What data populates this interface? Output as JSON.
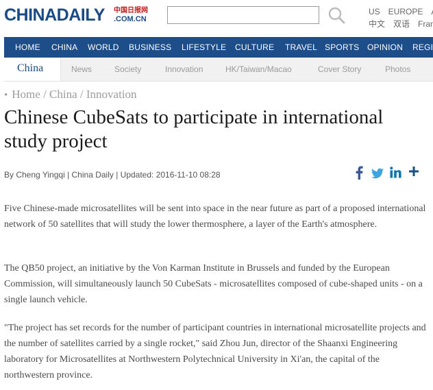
{
  "header": {
    "logo_text": "CHINADAILY",
    "logo_cn": "中国日报网",
    "logo_domain": ".COM.CN",
    "search": {
      "placeholder": ""
    },
    "lang_top": [
      "US",
      "EUROPE",
      "A"
    ],
    "lang_bottom": [
      "中文",
      "双语",
      "Fran"
    ]
  },
  "nav": {
    "items": [
      "HOME",
      "CHINA",
      "WORLD",
      "BUSINESS",
      "LIFESTYLE",
      "CULTURE",
      "TRAVEL",
      "SPORTS",
      "OPINION",
      "REGI"
    ]
  },
  "subnav": {
    "active": "China",
    "items": [
      "News",
      "Society",
      "Innovation",
      "HK/Taiwan/Macao",
      "Cover Story",
      "Photos"
    ]
  },
  "breadcrumb": {
    "items": [
      "Home",
      "China",
      "Innovation"
    ]
  },
  "article": {
    "title": "Chinese CubeSats to participate in international study project",
    "byline": "By Cheng Yingqi | China Daily | Updated: 2016-11-10 08:28",
    "paragraphs": [
      "Five Chinese-made microsatellites will be sent into space in the near future as part of a proposed international network of 50 satellites that will study the lower thermosphere, a layer of the Earth's atmosphere.",
      "The QB50 project, an initiative by the Von Karman Institute in Brussels and funded by the European Commission, will simultaneously launch 50 CubeSats - microsatellites composed of cube-shaped units - on a single launch vehicle.",
      "\"The project has set records for the number of participant countries in international microsatellite projects and the number of satellites carried by a single rocket,\" said Zhou Jun, director of the Shaanxi Engineering laboratory for Microsatellites at Northwestern Polytechnical University in Xi'an, the capital of the northwestern province."
    ]
  },
  "share": {
    "icons": [
      "facebook-icon",
      "twitter-icon",
      "linkedin-icon",
      "plus-icon"
    ],
    "colors": {
      "facebook": "#3b5998",
      "twitter": "#3fa3dd",
      "linkedin": "#0e76a8",
      "plus": "#1d4e89"
    }
  },
  "colors": {
    "brand": "#1d4e89",
    "logo": "#1a4b86",
    "logo_red": "#c21b1b"
  }
}
